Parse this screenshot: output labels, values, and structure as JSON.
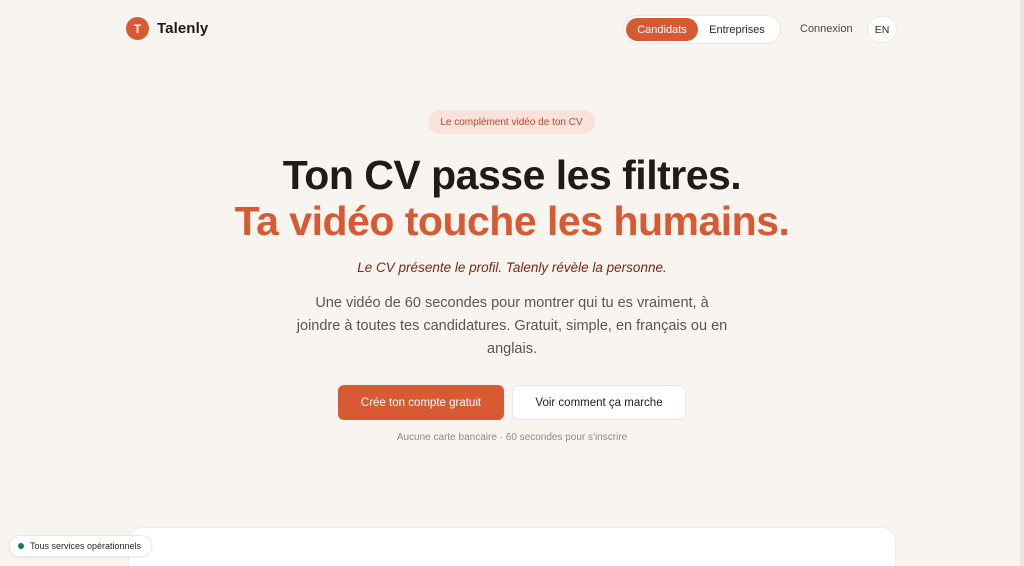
{
  "brand": {
    "logo_letter": "T",
    "name": "Talenly",
    "accent": "#d85a33"
  },
  "nav": {
    "tabs": [
      {
        "label": "Candidats",
        "active": true
      },
      {
        "label": "Entreprises",
        "active": false
      }
    ],
    "login": "Connexion",
    "lang": "EN"
  },
  "hero": {
    "badge": "Le complément vidéo de ton CV",
    "title_line1": "Ton CV passe les filtres.",
    "title_line2": "Ta vidéo touche les humains.",
    "tagline": "Le CV présente le profil. Talenly révèle la personne.",
    "description": "Une vidéo de 60 secondes pour montrer qui tu es vraiment, à joindre à toutes tes candidatures. Gratuit, simple, en français ou en anglais.",
    "cta_primary": "Crée ton compte gratuit",
    "cta_secondary": "Voir comment ça marche",
    "note": "Aucune carte bancaire · 60 secondes pour s'inscrire"
  },
  "status": {
    "label": "Tous services opérationnels",
    "color": "#1f7a4d"
  }
}
